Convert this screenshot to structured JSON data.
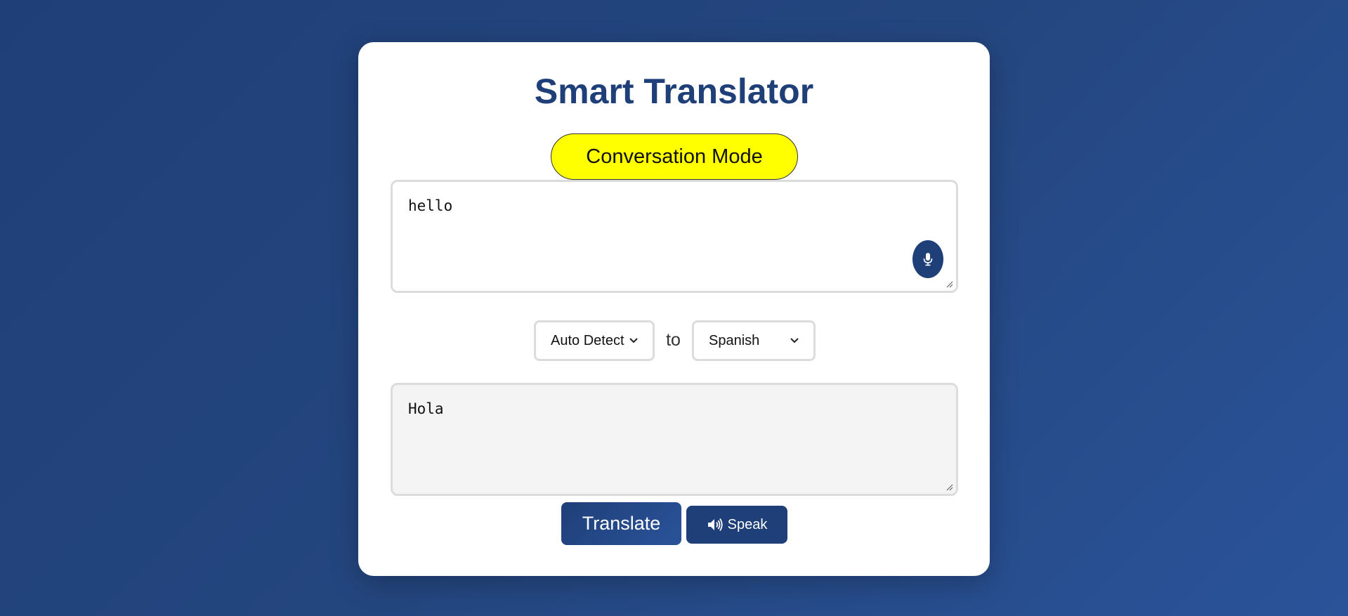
{
  "app": {
    "title": "Smart Translator"
  },
  "mode_button": {
    "label": "Conversation Mode"
  },
  "input": {
    "value": "hello"
  },
  "languages": {
    "from": "Auto Detect",
    "separator": "to",
    "to": "Spanish"
  },
  "output": {
    "value": "Hola"
  },
  "actions": {
    "translate_label": "Translate",
    "speak_label": "Speak"
  },
  "icons": {
    "mic": "microphone-icon",
    "speaker": "speaker-icon"
  },
  "colors": {
    "primary": "#1f3f78",
    "mode_button": "#ffff00",
    "card": "#ffffff",
    "output_bg": "#f4f4f4"
  }
}
